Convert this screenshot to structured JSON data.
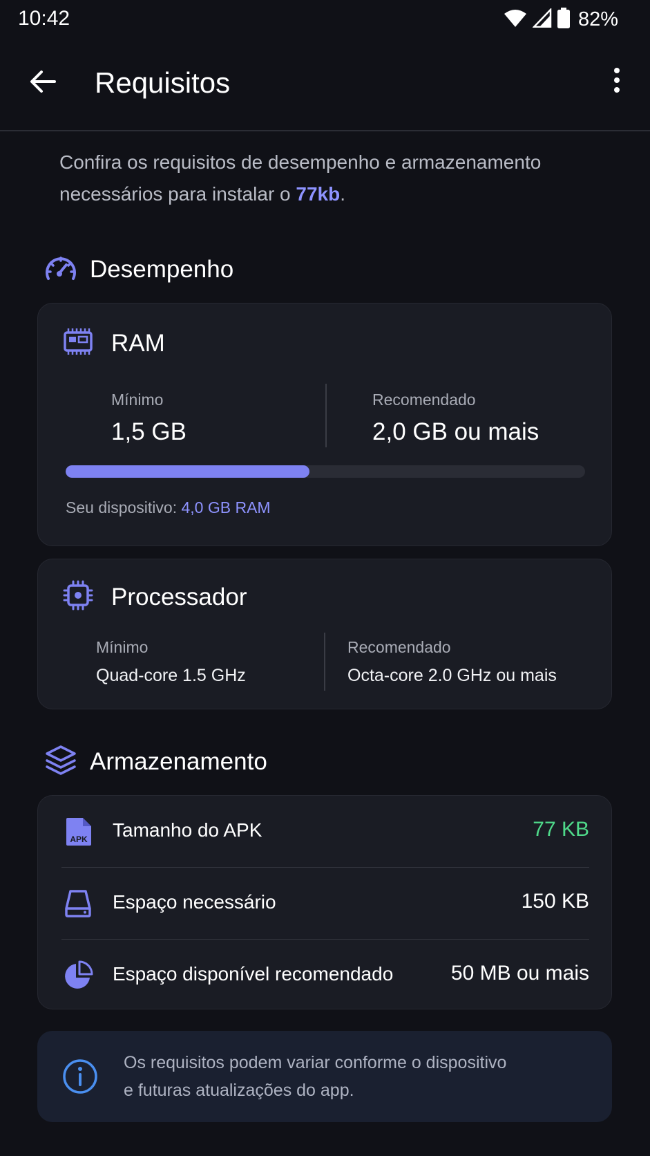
{
  "status_bar": {
    "time": "10:42",
    "battery_percent": "82%",
    "icons": [
      "wifi-icon",
      "signal-icon",
      "battery-icon"
    ]
  },
  "app_bar": {
    "title": "Requisitos",
    "icons": [
      "back-arrow-icon",
      "more-vert-icon"
    ]
  },
  "intro": {
    "text_before": "Confira os requisitos de desempenho e armazenamento necessários para instalar o ",
    "highlight": "77kb",
    "text_after": "."
  },
  "performance": {
    "title": "Desempenho",
    "icon": "speedometer-icon",
    "ram": {
      "title": "RAM",
      "icon": "memory-icon",
      "min_label": "Mínimo",
      "min_value": "1,5 GB",
      "rec_label": "Recomendado",
      "rec_value": "2,0 GB ou mais",
      "progress": 0.47,
      "device_label": "Seu dispositivo: ",
      "device_value": "4,0 GB RAM"
    },
    "cpu": {
      "title": "Processador",
      "icon": "chip-icon",
      "min_label": "Mínimo",
      "min_value": "Quad-core 1.5 GHz",
      "rec_label": "Recomendado",
      "rec_value": "Octa-core 2.0 GHz ou mais"
    }
  },
  "storage": {
    "title": "Armazenamento",
    "icon": "layers-icon",
    "rows": [
      {
        "icon": "apk-file-icon",
        "label": "Tamanho do APK",
        "value": "77 KB",
        "icon_text": "APK"
      },
      {
        "icon": "hard-drive-icon",
        "label": "Espaço necessário",
        "value": "150 KB"
      },
      {
        "icon": "pie-chart-icon",
        "label": "Espaço disponível recomendado",
        "value": "50 MB ou mais"
      }
    ]
  },
  "info": {
    "icon": "info-icon",
    "line1": "Os requisitos podem variar conforme o dispositivo",
    "line2": "e futuras atualizações do app."
  },
  "colors": {
    "background": "#101117",
    "card": "#1a1c24",
    "accent": "#7e82f2",
    "accent_text": "#8e93ff",
    "success": "#4fd98a",
    "info_bg": "#1a2030",
    "info_icon": "#4a8ff0"
  }
}
